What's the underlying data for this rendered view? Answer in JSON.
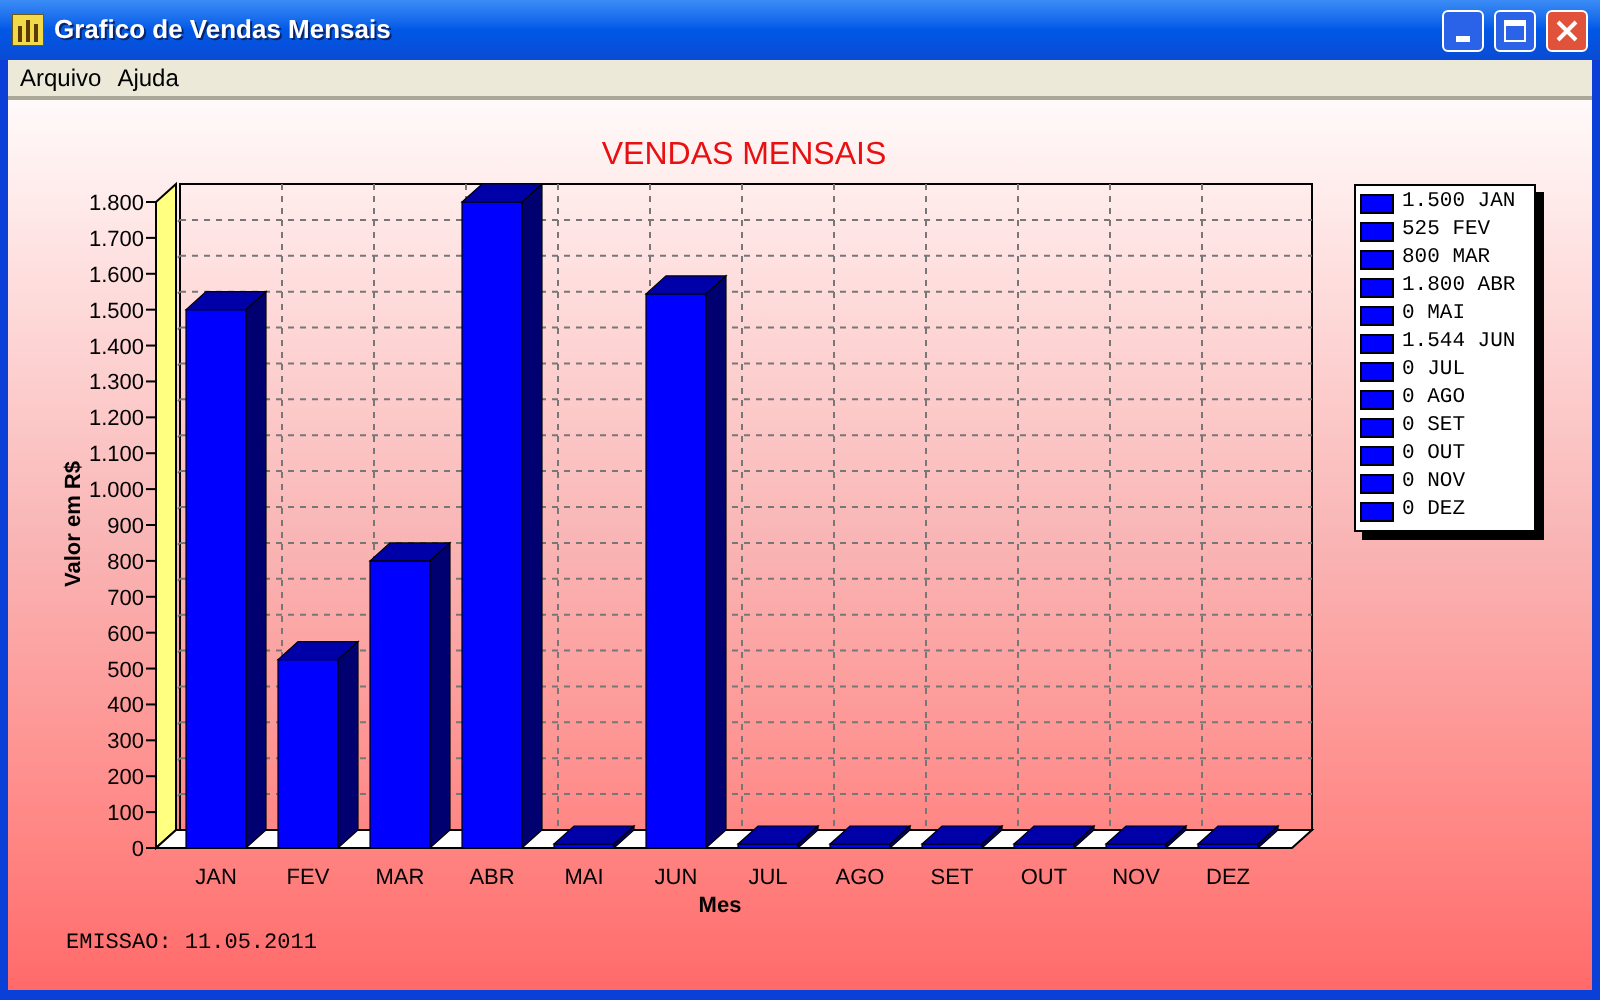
{
  "window": {
    "title": "Grafico de Vendas Mensais"
  },
  "menu": [
    "Arquivo",
    "Ajuda"
  ],
  "chart": {
    "chart_data": {
      "type": "bar",
      "title": "VENDAS MENSAIS",
      "xlabel": "Mes",
      "ylabel": "Valor em R$",
      "categories": [
        "JAN",
        "FEV",
        "MAR",
        "ABR",
        "MAI",
        "JUN",
        "JUL",
        "AGO",
        "SET",
        "OUT",
        "NOV",
        "DEZ"
      ],
      "series": [
        {
          "color": "#0000ff",
          "values": [
            1500,
            525,
            800,
            1800,
            0,
            1544,
            0,
            0,
            0,
            0,
            0,
            0
          ]
        }
      ],
      "ylim": [
        0,
        1800
      ],
      "yticks": [
        {
          "value": 0,
          "label": "0"
        },
        {
          "value": 100,
          "label": "100"
        },
        {
          "value": 200,
          "label": "200"
        },
        {
          "value": 300,
          "label": "300"
        },
        {
          "value": 400,
          "label": "400"
        },
        {
          "value": 500,
          "label": "500"
        },
        {
          "value": 600,
          "label": "600"
        },
        {
          "value": 700,
          "label": "700"
        },
        {
          "value": 800,
          "label": "800"
        },
        {
          "value": 900,
          "label": "900"
        },
        {
          "value": 1000,
          "label": "1.000"
        },
        {
          "value": 1100,
          "label": "1.100"
        },
        {
          "value": 1200,
          "label": "1.200"
        },
        {
          "value": 1300,
          "label": "1.300"
        },
        {
          "value": 1400,
          "label": "1.400"
        },
        {
          "value": 1500,
          "label": "1.500"
        },
        {
          "value": 1600,
          "label": "1.600"
        },
        {
          "value": 1700,
          "label": "1.700"
        },
        {
          "value": 1800,
          "label": "1.800"
        }
      ]
    },
    "legend": [
      "1.500 JAN",
      "525 FEV",
      "800 MAR",
      "1.800 ABR",
      "0 MAI",
      "1.544 JUN",
      "0 JUL",
      "0 AGO",
      "0 SET",
      "0 OUT",
      "0 NOV",
      "0 DEZ"
    ]
  },
  "footer": "EMISSAO: 11.05.2011"
}
